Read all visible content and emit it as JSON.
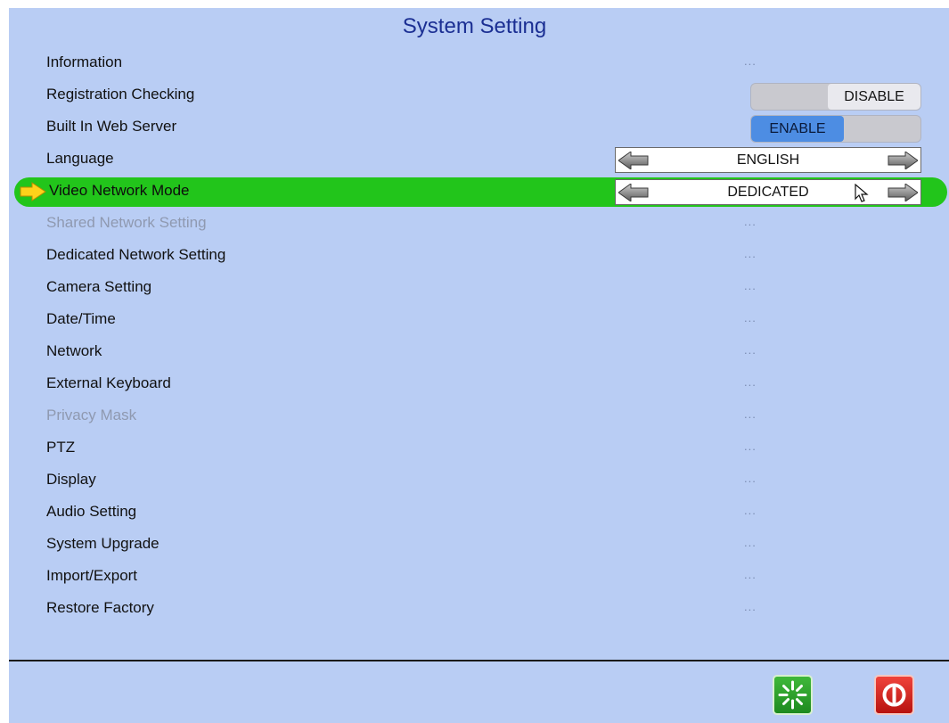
{
  "window": {
    "title": "System Setting"
  },
  "menu": {
    "items": [
      {
        "label": "Information",
        "value": "...",
        "type": "link",
        "enabled": true
      },
      {
        "label": "Registration Checking",
        "value": "DISABLE",
        "type": "toggle",
        "state": "disable",
        "enabled": true
      },
      {
        "label": "Built In Web Server",
        "value": "ENABLE",
        "type": "toggle",
        "state": "enable",
        "enabled": true
      },
      {
        "label": "Language",
        "value": "ENGLISH",
        "type": "selector",
        "enabled": true
      },
      {
        "label": "Video Network Mode",
        "value": "DEDICATED",
        "type": "selector",
        "enabled": true,
        "selected": true
      },
      {
        "label": "Shared Network Setting",
        "value": "...",
        "type": "link",
        "enabled": false
      },
      {
        "label": "Dedicated Network Setting",
        "value": "...",
        "type": "link",
        "enabled": true
      },
      {
        "label": "Camera Setting",
        "value": "...",
        "type": "link",
        "enabled": true
      },
      {
        "label": "Date/Time",
        "value": "...",
        "type": "link",
        "enabled": true
      },
      {
        "label": "Network",
        "value": "...",
        "type": "link",
        "enabled": true
      },
      {
        "label": "External Keyboard",
        "value": "...",
        "type": "link",
        "enabled": true
      },
      {
        "label": "Privacy Mask",
        "value": "...",
        "type": "link",
        "enabled": false
      },
      {
        "label": "PTZ",
        "value": "...",
        "type": "link",
        "enabled": true
      },
      {
        "label": "Display",
        "value": "...",
        "type": "link",
        "enabled": true
      },
      {
        "label": "Audio Setting",
        "value": "...",
        "type": "link",
        "enabled": true
      },
      {
        "label": "System Upgrade",
        "value": "...",
        "type": "link",
        "enabled": true
      },
      {
        "label": "Import/Export",
        "value": "...",
        "type": "link",
        "enabled": true
      },
      {
        "label": "Restore Factory",
        "value": "...",
        "type": "link",
        "enabled": true
      }
    ]
  },
  "footer": {
    "apply_icon": "apply-spinner-icon",
    "exit_icon": "power-icon"
  },
  "colors": {
    "background": "#b9cdf4",
    "title": "#1b2f93",
    "highlight": "#22c51b",
    "enable_toggle": "#4d8de3",
    "apply_button": "#2ea02b",
    "exit_button": "#d8201a"
  }
}
